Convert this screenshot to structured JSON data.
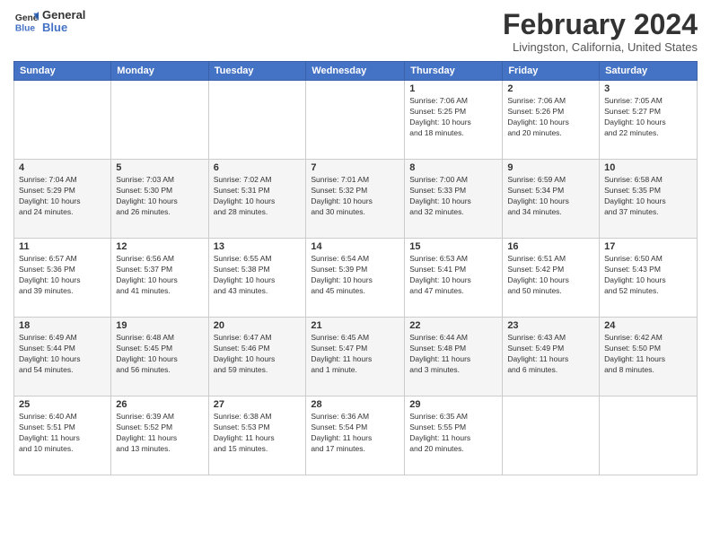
{
  "header": {
    "logo": {
      "line1": "General",
      "line2": "Blue"
    },
    "title": "February 2024",
    "location": "Livingston, California, United States"
  },
  "days_of_week": [
    "Sunday",
    "Monday",
    "Tuesday",
    "Wednesday",
    "Thursday",
    "Friday",
    "Saturday"
  ],
  "weeks": [
    [
      {
        "day": "",
        "info": ""
      },
      {
        "day": "",
        "info": ""
      },
      {
        "day": "",
        "info": ""
      },
      {
        "day": "",
        "info": ""
      },
      {
        "day": "1",
        "info": "Sunrise: 7:06 AM\nSunset: 5:25 PM\nDaylight: 10 hours\nand 18 minutes."
      },
      {
        "day": "2",
        "info": "Sunrise: 7:06 AM\nSunset: 5:26 PM\nDaylight: 10 hours\nand 20 minutes."
      },
      {
        "day": "3",
        "info": "Sunrise: 7:05 AM\nSunset: 5:27 PM\nDaylight: 10 hours\nand 22 minutes."
      }
    ],
    [
      {
        "day": "4",
        "info": "Sunrise: 7:04 AM\nSunset: 5:29 PM\nDaylight: 10 hours\nand 24 minutes."
      },
      {
        "day": "5",
        "info": "Sunrise: 7:03 AM\nSunset: 5:30 PM\nDaylight: 10 hours\nand 26 minutes."
      },
      {
        "day": "6",
        "info": "Sunrise: 7:02 AM\nSunset: 5:31 PM\nDaylight: 10 hours\nand 28 minutes."
      },
      {
        "day": "7",
        "info": "Sunrise: 7:01 AM\nSunset: 5:32 PM\nDaylight: 10 hours\nand 30 minutes."
      },
      {
        "day": "8",
        "info": "Sunrise: 7:00 AM\nSunset: 5:33 PM\nDaylight: 10 hours\nand 32 minutes."
      },
      {
        "day": "9",
        "info": "Sunrise: 6:59 AM\nSunset: 5:34 PM\nDaylight: 10 hours\nand 34 minutes."
      },
      {
        "day": "10",
        "info": "Sunrise: 6:58 AM\nSunset: 5:35 PM\nDaylight: 10 hours\nand 37 minutes."
      }
    ],
    [
      {
        "day": "11",
        "info": "Sunrise: 6:57 AM\nSunset: 5:36 PM\nDaylight: 10 hours\nand 39 minutes."
      },
      {
        "day": "12",
        "info": "Sunrise: 6:56 AM\nSunset: 5:37 PM\nDaylight: 10 hours\nand 41 minutes."
      },
      {
        "day": "13",
        "info": "Sunrise: 6:55 AM\nSunset: 5:38 PM\nDaylight: 10 hours\nand 43 minutes."
      },
      {
        "day": "14",
        "info": "Sunrise: 6:54 AM\nSunset: 5:39 PM\nDaylight: 10 hours\nand 45 minutes."
      },
      {
        "day": "15",
        "info": "Sunrise: 6:53 AM\nSunset: 5:41 PM\nDaylight: 10 hours\nand 47 minutes."
      },
      {
        "day": "16",
        "info": "Sunrise: 6:51 AM\nSunset: 5:42 PM\nDaylight: 10 hours\nand 50 minutes."
      },
      {
        "day": "17",
        "info": "Sunrise: 6:50 AM\nSunset: 5:43 PM\nDaylight: 10 hours\nand 52 minutes."
      }
    ],
    [
      {
        "day": "18",
        "info": "Sunrise: 6:49 AM\nSunset: 5:44 PM\nDaylight: 10 hours\nand 54 minutes."
      },
      {
        "day": "19",
        "info": "Sunrise: 6:48 AM\nSunset: 5:45 PM\nDaylight: 10 hours\nand 56 minutes."
      },
      {
        "day": "20",
        "info": "Sunrise: 6:47 AM\nSunset: 5:46 PM\nDaylight: 10 hours\nand 59 minutes."
      },
      {
        "day": "21",
        "info": "Sunrise: 6:45 AM\nSunset: 5:47 PM\nDaylight: 11 hours\nand 1 minute."
      },
      {
        "day": "22",
        "info": "Sunrise: 6:44 AM\nSunset: 5:48 PM\nDaylight: 11 hours\nand 3 minutes."
      },
      {
        "day": "23",
        "info": "Sunrise: 6:43 AM\nSunset: 5:49 PM\nDaylight: 11 hours\nand 6 minutes."
      },
      {
        "day": "24",
        "info": "Sunrise: 6:42 AM\nSunset: 5:50 PM\nDaylight: 11 hours\nand 8 minutes."
      }
    ],
    [
      {
        "day": "25",
        "info": "Sunrise: 6:40 AM\nSunset: 5:51 PM\nDaylight: 11 hours\nand 10 minutes."
      },
      {
        "day": "26",
        "info": "Sunrise: 6:39 AM\nSunset: 5:52 PM\nDaylight: 11 hours\nand 13 minutes."
      },
      {
        "day": "27",
        "info": "Sunrise: 6:38 AM\nSunset: 5:53 PM\nDaylight: 11 hours\nand 15 minutes."
      },
      {
        "day": "28",
        "info": "Sunrise: 6:36 AM\nSunset: 5:54 PM\nDaylight: 11 hours\nand 17 minutes."
      },
      {
        "day": "29",
        "info": "Sunrise: 6:35 AM\nSunset: 5:55 PM\nDaylight: 11 hours\nand 20 minutes."
      },
      {
        "day": "",
        "info": ""
      },
      {
        "day": "",
        "info": ""
      }
    ]
  ]
}
